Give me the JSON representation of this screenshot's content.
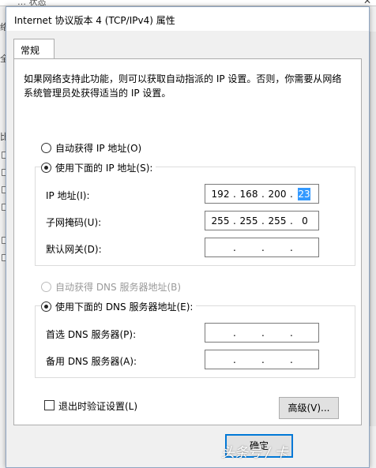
{
  "dialog": {
    "title": "Internet 协议版本 4 (TCP/IPv4) 属性",
    "tab": "常规",
    "description": "如果网络支持此功能，则可以获取自动指派的 IP 设置。否则，你需要从网络系统管理员处获得适当的 IP 设置。"
  },
  "ip": {
    "auto_label": "自动获得 IP 地址(O)",
    "manual_label": "使用下面的 IP 地址(S):",
    "address_label": "IP 地址(I):",
    "subnet_label": "子网掩码(U):",
    "gateway_label": "默认网关(D):",
    "address": [
      "192",
      "168",
      "200",
      "23"
    ],
    "subnet": [
      "255",
      "255",
      "255",
      "0"
    ]
  },
  "dns": {
    "auto_label": "自动获得 DNS 服务器地址(B)",
    "manual_label": "使用下面的 DNS 服务器地址(E):",
    "preferred_label": "首选 DNS 服务器(P):",
    "alternate_label": "备用 DNS 服务器(A):"
  },
  "footer": {
    "validate_label": "退出时验证设置(L)",
    "advanced_label": "高级(V)...",
    "ok_label": "确定"
  },
  "watermark": "头条号 / 卡",
  "background": {
    "title_fragment": "… 状态",
    "side_glyphs": [
      "络",
      "全",
      "比"
    ]
  },
  "colors": {
    "selection": "#3399ff",
    "default_button_border": "#0078d7"
  }
}
